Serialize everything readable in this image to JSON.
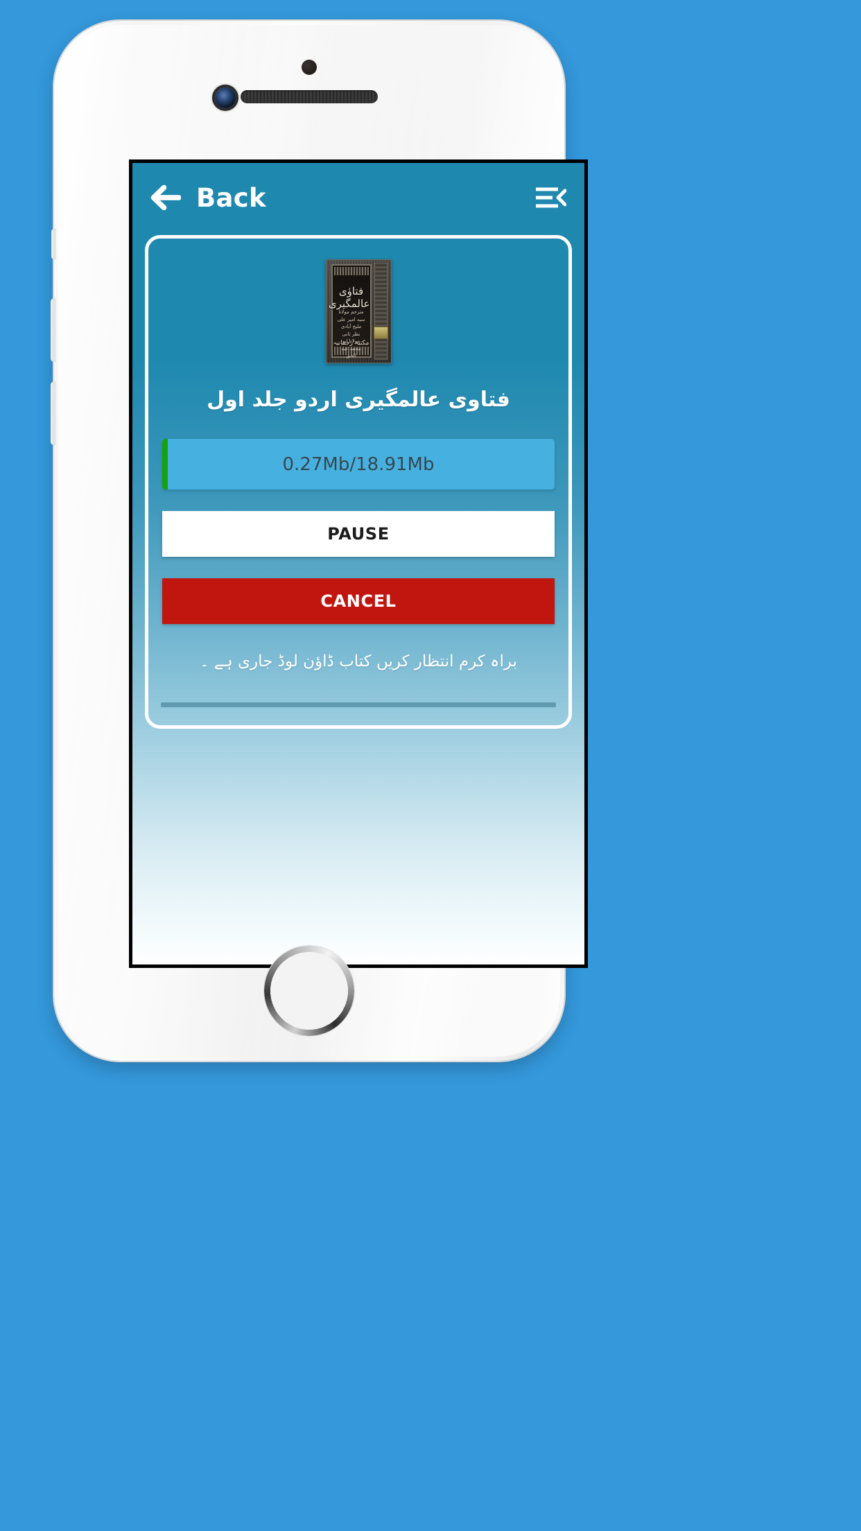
{
  "app": {
    "background_color": "#3498db",
    "screen_top_color": "#1e88af",
    "accent_green": "#17a10f",
    "cancel_red": "#c1160f",
    "progress_track": "#46b1e0"
  },
  "appbar": {
    "back_label": "Back",
    "back_icon": "arrow-left-icon",
    "menu_icon": "menu-collapse-icon"
  },
  "book": {
    "title_urdu": "فتاوی عالمگیری اردو جلد اول",
    "cover": {
      "title_urdu": "فتاوٰی عالمگیری",
      "subtitle_urdu": "مترجم\nمولانا سید امیر علی ملیح آبادی\nنظر ثانی\nمولانا ابو محمد عبد الحق",
      "publisher_urdu": "مکتبہ رحمانیہ",
      "alt": "book-cover-thumbnail"
    }
  },
  "download": {
    "progress_text": "0.27Mb/18.91Mb",
    "downloaded_mb": 0.27,
    "total_mb": 18.91,
    "percent": 1.4,
    "pause_label": "PAUSE",
    "cancel_label": "CANCEL",
    "status_urdu": "براہ کرم انتظار کریں کتاب ڈاؤن لوڈ جاری ہے ۔"
  }
}
